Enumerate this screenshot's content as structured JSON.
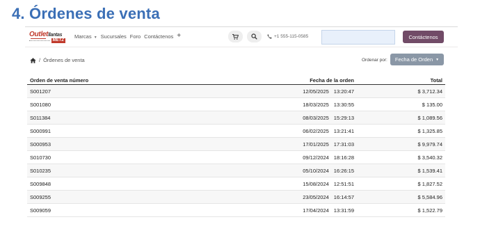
{
  "doc_heading": "4. Órdenes de venta",
  "logo": {
    "part1": "Outlet",
    "part2": "llantas",
    "part3": "METZ"
  },
  "nav": {
    "links": [
      {
        "label": "Marcas",
        "has_caret": true
      },
      {
        "label": "Sucursales"
      },
      {
        "label": "Foro"
      },
      {
        "label": "Contáctenos"
      }
    ],
    "plus_label": "+",
    "phone": "+1 555-115-0585",
    "search_value": "",
    "contact_button": "Contáctenos"
  },
  "breadcrumb": {
    "separator": "/",
    "current": "Órdenes de venta"
  },
  "order_by": {
    "label": "Ordenar por:",
    "value": "Fecha de Orden"
  },
  "table": {
    "headers": [
      "Orden de venta número",
      "Fecha de la orden",
      "Total"
    ],
    "rows": [
      {
        "order": "S001207",
        "date": "12/05/2025",
        "time": "13:20:47",
        "total": "$ 3,712.34"
      },
      {
        "order": "S001080",
        "date": "18/03/2025",
        "time": "13:30:55",
        "total": "$ 135.00"
      },
      {
        "order": "S011384",
        "date": "08/03/2025",
        "time": "15:29:13",
        "total": "$ 1,089.56"
      },
      {
        "order": "S000991",
        "date": "06/02/2025",
        "time": "13:21:41",
        "total": "$ 1,325.85"
      },
      {
        "order": "S000953",
        "date": "17/01/2025",
        "time": "17:31:03",
        "total": "$ 9,979.74"
      },
      {
        "order": "S010730",
        "date": "09/12/2024",
        "time": "18:16:28",
        "total": "$ 3,540.32"
      },
      {
        "order": "S010235",
        "date": "05/10/2024",
        "time": "16:26:15",
        "total": "$ 1,539.41"
      },
      {
        "order": "S009848",
        "date": "15/08/2024",
        "time": "12:51:51",
        "total": "$ 1,827.52"
      },
      {
        "order": "S009255",
        "date": "23/05/2024",
        "time": "16:14:57",
        "total": "$ 5,584.96"
      },
      {
        "order": "S009059",
        "date": "17/04/2024",
        "time": "13:31:59",
        "total": "$ 1,522.79"
      }
    ]
  },
  "colors": {
    "heading": "#3b6fb6",
    "contact_button": "#714b67",
    "order_by_button": "#8a97a6",
    "logo_red": "#c0392b"
  }
}
